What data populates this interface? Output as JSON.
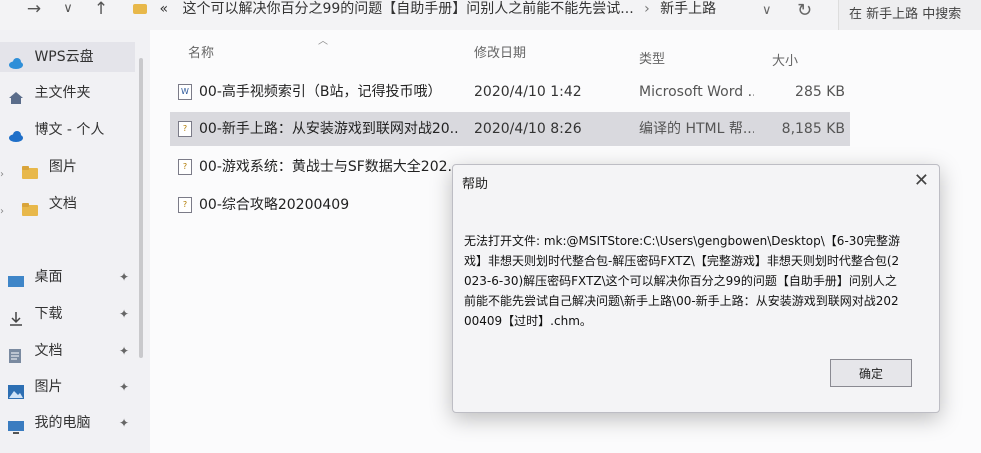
{
  "nav": {
    "back": "→",
    "history": "∨",
    "up": "↑"
  },
  "address": {
    "prefix": "«",
    "path": "这个可以解决你百分之99的问题【自助手册】问别人之前能不能先尝试...",
    "current": "新手上路",
    "separator": "›"
  },
  "search": {
    "placeholder": "在 新手上路 中搜索"
  },
  "sidebar": {
    "items": [
      {
        "label": "WPS云盘",
        "icon": "cloud-icon"
      },
      {
        "label": "主文件夹",
        "icon": "home-icon"
      },
      {
        "label": "博文 - 个人",
        "icon": "cloud-icon"
      },
      {
        "label": "图片",
        "icon": "folder-icon"
      },
      {
        "label": "文档",
        "icon": "folder-icon"
      },
      {
        "label": "桌面",
        "icon": "desktop-icon",
        "pin": "📌"
      },
      {
        "label": "下载",
        "icon": "download-icon",
        "pin": "📌"
      },
      {
        "label": "文档",
        "icon": "document-icon",
        "pin": "📌"
      },
      {
        "label": "图片",
        "icon": "picture-icon",
        "pin": "📌"
      },
      {
        "label": "我的电脑",
        "icon": "computer-icon",
        "pin": "📌"
      }
    ]
  },
  "columns": {
    "name": "名称",
    "date": "修改日期",
    "type": "类型",
    "size": "大小"
  },
  "files": [
    {
      "name": "00-高手视频索引（B站，记得投币哦）",
      "date": "2020/4/10 1:42",
      "type": "Microsoft Word ...",
      "size": "285 KB",
      "icon": "word-doc-icon"
    },
    {
      "name": "00-新手上路：从安装游戏到联网对战20...",
      "date": "2020/4/10 8:26",
      "type": "编译的 HTML 帮...",
      "size": "8,185 KB",
      "icon": "chm-file-icon"
    },
    {
      "name": "00-游戏系统：黄战士与SF数据大全202...",
      "date": "",
      "type": "",
      "size": "",
      "icon": "chm-file-icon"
    },
    {
      "name": "00-综合攻略20200409",
      "date": "",
      "type": "",
      "size": "",
      "icon": "chm-file-icon"
    }
  ],
  "dialog": {
    "title": "帮助",
    "close": "✕",
    "message": "无法打开文件: mk:@MSITStore:C:\\Users\\gengbowen\\Desktop\\【6-30完整游戏】非想天则划时代整合包-解压密码FXTZ\\【完整游戏】非想天则划时代整合包(2023-6-30)解压密码FXTZ\\这个可以解决你百分之99的问题【自助手册】问别人之前能不能先尝试自己解决问题\\新手上路\\00-新手上路：从安装游戏到联网对战20200409【过时】.chm。",
    "ok": "确定"
  },
  "colors": {
    "selected_row": "#d9d9de",
    "folder": "#e8b84a",
    "cloud": "#2f8fd8"
  }
}
